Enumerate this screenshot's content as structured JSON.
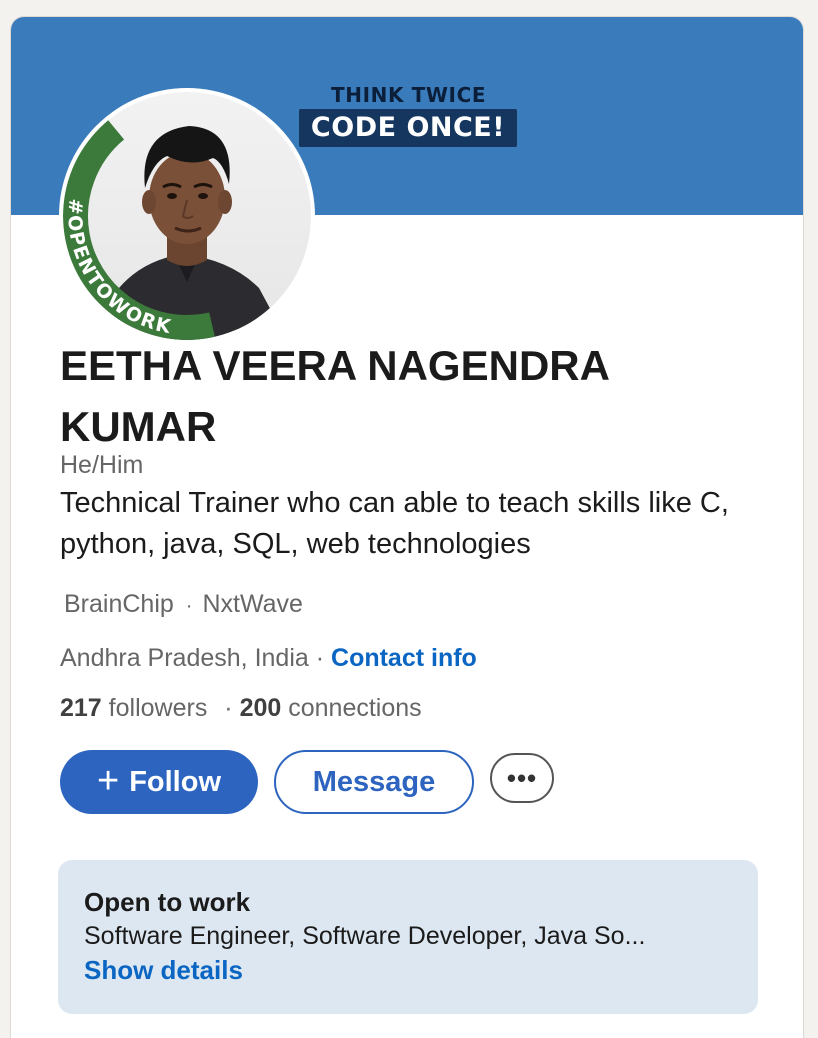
{
  "banner": {
    "line1": "THINK TWICE",
    "line2": "CODE ONCE!"
  },
  "avatar": {
    "frame_text": "#OPENTOWORK",
    "frame_color": "#3b7a3a"
  },
  "profile": {
    "name": "EETHA VEERA NAGENDRA KUMAR",
    "pronouns": "He/Him",
    "headline": "Technical Trainer who can able to teach skills like C, python, java, SQL, web technologies",
    "companies": [
      "BrainChip",
      "NxtWave"
    ],
    "company_separator": "·",
    "location": "Andhra Pradesh, India",
    "location_separator": "·",
    "contact_label": "Contact info",
    "followers_count": "217",
    "followers_label": "followers",
    "stats_separator": "·",
    "connections_count": "200",
    "connections_label": "connections"
  },
  "actions": {
    "follow_plus": "+",
    "follow_label": "Follow",
    "message_label": "Message",
    "more_label": "•••"
  },
  "open_to_work": {
    "title": "Open to work",
    "roles": "Software Engineer, Software Developer, Java So...",
    "link": "Show details"
  },
  "colors": {
    "banner": "#3a7cbb",
    "primary": "#2c64bf",
    "link": "#0a66c2",
    "otw_bg": "#dde7f1"
  }
}
